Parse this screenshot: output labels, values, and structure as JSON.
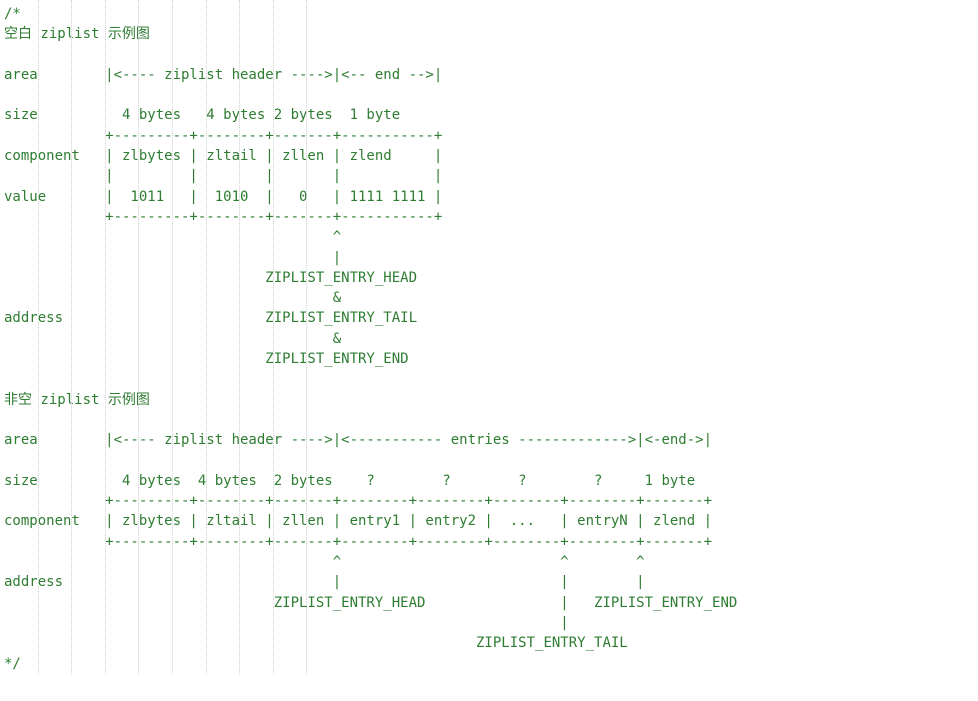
{
  "lines": [
    "/*",
    "空白 ziplist 示例图",
    "",
    "area        |<---- ziplist header ---->|<-- end -->|",
    "",
    "size          4 bytes   4 bytes 2 bytes  1 byte",
    "            +---------+--------+-------+-----------+",
    "component   | zlbytes | zltail | zllen | zlend     |",
    "            |         |        |       |           |",
    "value       |  1011   |  1010  |   0   | 1111 1111 |",
    "            +---------+--------+-------+-----------+",
    "                                       ^",
    "                                       |",
    "                               ZIPLIST_ENTRY_HEAD",
    "                                       &",
    "address                        ZIPLIST_ENTRY_TAIL",
    "                                       &",
    "                               ZIPLIST_ENTRY_END",
    "",
    "非空 ziplist 示例图",
    "",
    "area        |<---- ziplist header ---->|<----------- entries ------------->|<-end->|",
    "",
    "size          4 bytes  4 bytes  2 bytes    ?        ?        ?        ?     1 byte",
    "            +---------+--------+-------+--------+--------+--------+--------+-------+",
    "component   | zlbytes | zltail | zllen | entry1 | entry2 |  ...   | entryN | zlend |",
    "            +---------+--------+-------+--------+--------+--------+--------+-------+",
    "                                       ^                          ^        ^",
    "address                                |                          |        |",
    "                                ZIPLIST_ENTRY_HEAD                |   ZIPLIST_ENTRY_END",
    "                                                                  |",
    "                                                        ZIPLIST_ENTRY_TAIL",
    "*/"
  ],
  "guide_positions_ch": [
    4,
    8,
    12,
    16,
    20,
    24,
    28,
    32,
    36
  ]
}
